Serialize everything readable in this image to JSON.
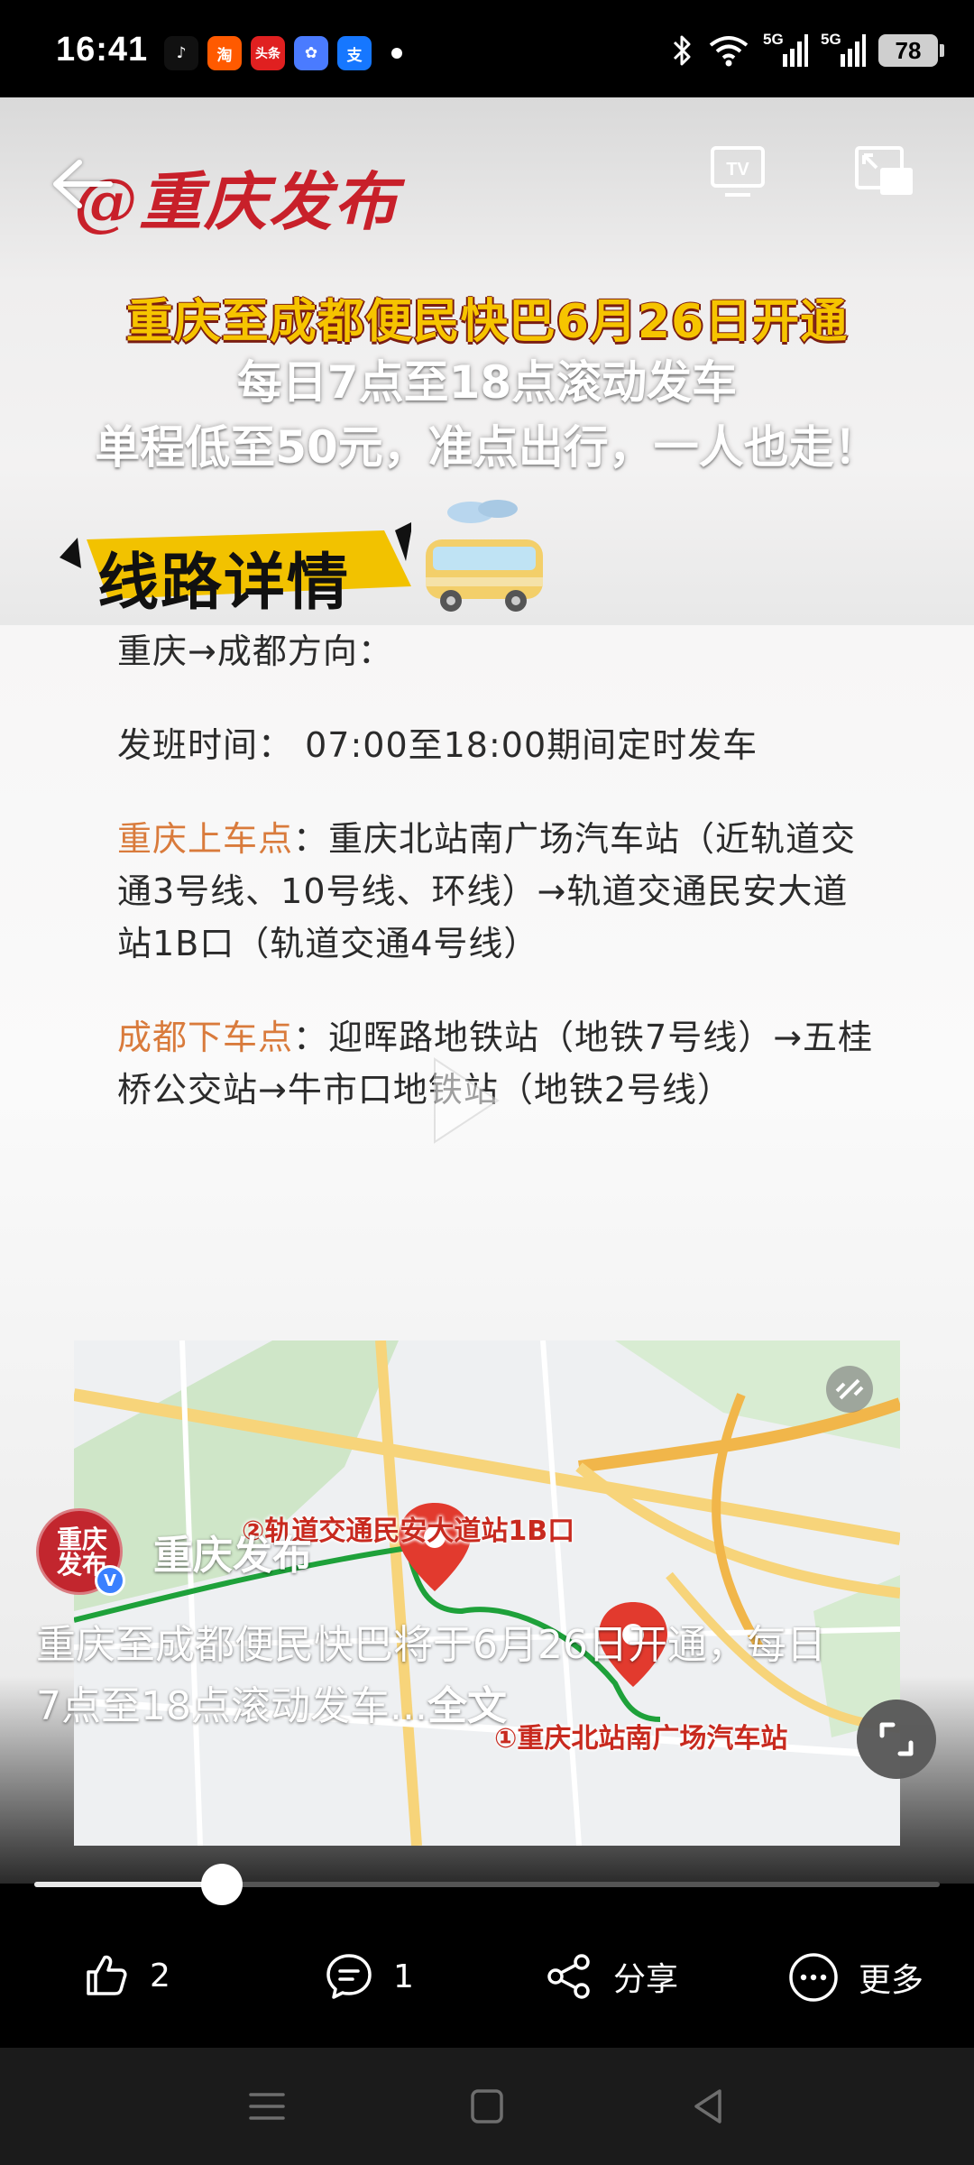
{
  "status_bar": {
    "time": "16:41",
    "apps": [
      {
        "name": "douyin",
        "label": "♪",
        "color": "#111111"
      },
      {
        "name": "taobao",
        "label": "淘",
        "color": "#ff5a00"
      },
      {
        "name": "toutiao",
        "label": "头条",
        "color": "#e02020"
      },
      {
        "name": "photos",
        "label": "✿",
        "color": "#4a7bff"
      },
      {
        "name": "alipay",
        "label": "支",
        "color": "#1677ff"
      }
    ],
    "battery": "78",
    "network_1": "5G",
    "network_2": "5G"
  },
  "poster": {
    "brand": "@重庆发布",
    "headline_1": "重庆至成都便民快巴6月26日开通",
    "headline_2": "每日7点至18点滚动发车",
    "headline_3": "单程低至50元，准点出行，一人也走！",
    "route_banner": "线路详情"
  },
  "article": {
    "direction": "重庆→成都方向：",
    "schedule_label": "发班时间：",
    "schedule_value": "07:00至18:00期间定时发车",
    "pickup_label": "重庆上车点",
    "pickup_value": "：重庆北站南广场汽车站（近轨道交通3号线、10号线、环线）→轨道交通民安大道站1B口（轨道交通4号线）",
    "dropoff_label": "成都下车点",
    "dropoff_value": "：迎晖路地铁站（地铁7号线）→五桂桥公交站→牛市口地铁站（地铁2号线）"
  },
  "map": {
    "label_2": "②轨道交通民安大道站1B口",
    "label_1": "①重庆北站南广场汽车站"
  },
  "account": {
    "avatar_text": "重庆发布",
    "name": "重庆发布",
    "verified": "V"
  },
  "caption": {
    "text": "重庆至成都便民快巴将于6月26日开通，每日7点至18点滚动发车...",
    "more": "全文"
  },
  "progress": {
    "fraction": 0.207
  },
  "actions": {
    "like_count": "2",
    "comment_count": "1",
    "share_label": "分享",
    "more_label": "更多"
  }
}
